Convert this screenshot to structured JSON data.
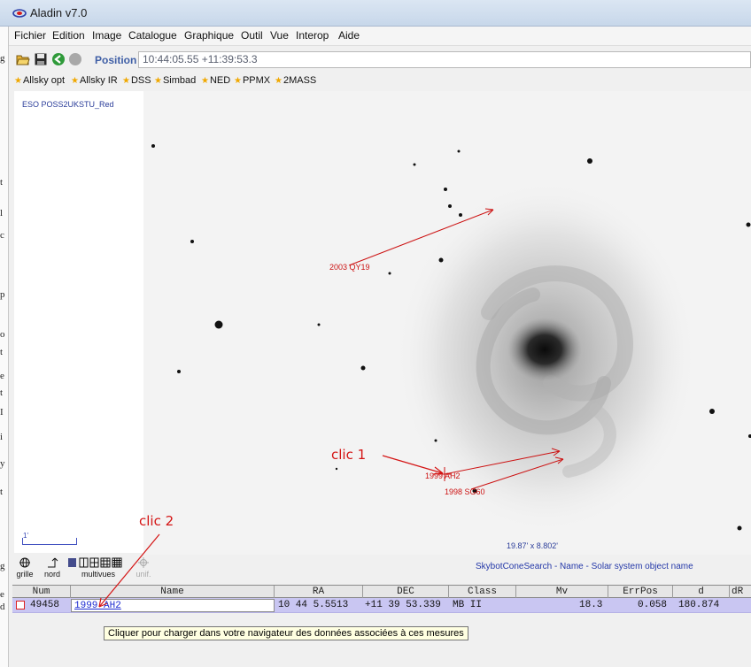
{
  "window": {
    "title": "Aladin v7.0"
  },
  "menu": [
    "Fichier",
    "Edition",
    "Image",
    "Catalogue",
    "Graphique",
    "Outil",
    "Vue",
    "Interop",
    "Aide"
  ],
  "toolbar": {
    "position_label": "Position",
    "position_value": "10:44:05.55 +11:39:53.3"
  },
  "surveys": [
    "Allsky opt",
    "Allsky IR",
    "DSS",
    "Simbad",
    "NED",
    "PPMX",
    "2MASS"
  ],
  "stack": {
    "plane_label": "ESO POSS2UKSTU_Red",
    "scale_label": "1'"
  },
  "view": {
    "fov": "19.87' x 8.802'",
    "objects": {
      "obj1": "2003 QY19",
      "obj2": "1999 AH2",
      "obj3": "1998 SG60"
    }
  },
  "lowertools": {
    "grid": "grille",
    "north": "nord",
    "multiview": "multivues",
    "unif": "unif."
  },
  "status_message": "SkybotConeSearch - Name - Solar system object name",
  "table": {
    "columns": [
      "Num",
      "Name",
      "RA",
      "DEC",
      "Class",
      "Mv",
      "ErrPos",
      "d",
      "dR"
    ],
    "row": {
      "num": "49458",
      "name": "1999 AH2",
      "ra": "10 44 5.5513",
      "dec": "+11 39 53.339",
      "class": "MB II",
      "mv": "18.3",
      "errpos": "0.058",
      "d": "180.874"
    }
  },
  "tooltip": "Cliquer pour charger dans votre navigateur des données associées à ces mesures",
  "annotations": {
    "click1": "clic 1",
    "click2": "clic 2"
  },
  "left_strip_chars": [
    "g",
    "t",
    "l",
    "c",
    "p",
    "o",
    "t",
    "e",
    "t",
    "I",
    "i",
    "y",
    "t",
    "g",
    "e",
    "d"
  ],
  "colors": {
    "accent": "#3f5fa6",
    "annotation": "#d41414",
    "overlay": "#cc1111",
    "row_selected": "#c9c6f2"
  }
}
